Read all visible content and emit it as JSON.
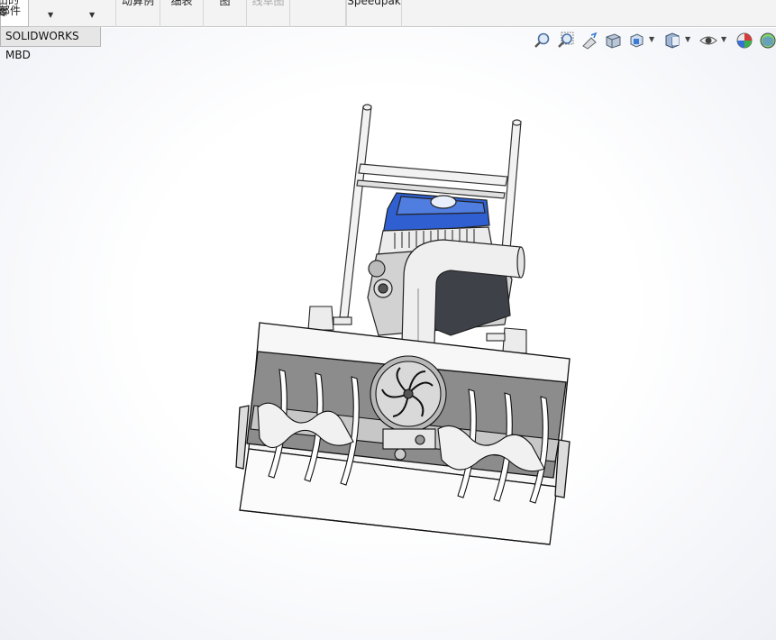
{
  "ribbon": {
    "parts_line1": "出的零",
    "parts_line2": "部件",
    "items": [
      {
        "id": "rb-2",
        "label": "动算例",
        "disabled": false
      },
      {
        "id": "rb-3",
        "label": "细表",
        "disabled": false
      },
      {
        "id": "rb-4",
        "label": "图",
        "disabled": false
      },
      {
        "id": "rb-5",
        "label": "线草图",
        "disabled": true
      },
      {
        "id": "rb-6",
        "label": "",
        "disabled": false
      },
      {
        "id": "rb-7",
        "label": "Speedpak",
        "disabled": false
      }
    ]
  },
  "tab": {
    "label": "SOLIDWORKS MBD"
  },
  "heads_up_toolbar": {
    "icons": [
      "zoom-to-fit-icon",
      "zoom-to-area-icon",
      "previous-view-icon",
      "section-view-icon",
      "view-orientation-icon",
      "display-style-icon",
      "hide-show-items-icon",
      "edit-appearance-icon",
      "apply-scene-icon"
    ]
  },
  "colors": {
    "engine_blue": "#2f5fd0",
    "frame_gray": "#d8d8d8",
    "auger_gray": "#8c8c8c"
  }
}
